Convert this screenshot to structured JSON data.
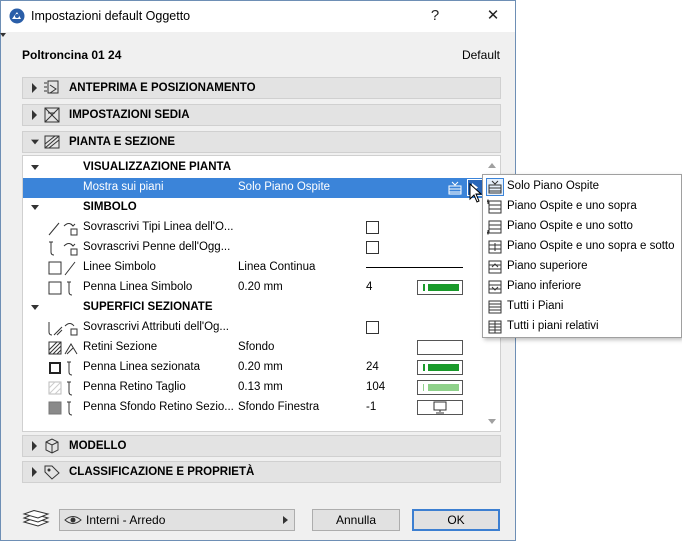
{
  "window": {
    "title": "Impostazioni default Oggetto",
    "help_glyph": "?",
    "close_glyph": "✕"
  },
  "header": {
    "object_name": "Poltroncina 01 24",
    "default_label": "Default"
  },
  "sections": {
    "preview": "ANTEPRIMA E POSIZIONAMENTO",
    "chair": "IMPOSTAZIONI SEDIA",
    "plan": "PIANTA E SEZIONE",
    "model": "MODELLO",
    "classification": "CLASSIFICAZIONE E PROPRIETÀ"
  },
  "plan_panel": {
    "group_display": "VISUALIZZAZIONE PIANTA",
    "show_on_floors": {
      "name": "Mostra sui piani",
      "value": "Solo Piano Ospite"
    },
    "group_symbol": "SIMBOLO",
    "override_line_types": {
      "name": "Sovrascrivi Tipi Linea dell'O...",
      "checked": false
    },
    "override_pens": {
      "name": "Sovrascrivi Penne dell'Ogg...",
      "checked": false
    },
    "symbol_lines": {
      "name": "Linee Simbolo",
      "value": "Linea Continua"
    },
    "symbol_line_pen": {
      "name": "Penna Linea Simbolo",
      "value": "0.20 mm",
      "pen": "4",
      "pen_color": "#1a9a2a"
    },
    "group_cut": "SUPERFICI SEZIONATE",
    "override_cut_attrs": {
      "name": "Sovrascrivi Attributi dell'Og...",
      "checked": false
    },
    "cut_fills": {
      "name": "Retini Sezione",
      "value": "Sfondo"
    },
    "cut_line_pen": {
      "name": "Penna Linea sezionata",
      "value": "0.20 mm",
      "pen": "24",
      "pen_color": "#1a9a2a"
    },
    "cut_fill_pen": {
      "name": "Penna Retino Taglio",
      "value": "0.13 mm",
      "pen": "104",
      "pen_color": "#8fd18a"
    },
    "cut_bg_pen": {
      "name": "Penna Sfondo Retino Sezio...",
      "value": "Sfondo Finestra",
      "pen": "-1"
    }
  },
  "footer": {
    "layer_combo": "Interni - Arredo",
    "cancel_label": "Annulla",
    "ok_label": "OK"
  },
  "floor_menu": {
    "items": [
      "Solo Piano Ospite",
      "Piano Ospite e uno sopra",
      "Piano Ospite e uno sotto",
      "Piano Ospite e uno sopra e sotto",
      "Piano superiore",
      "Piano inferiore",
      "Tutti i Piani",
      "Tutti i piani relativi"
    ],
    "active_index": 0
  },
  "colors": {
    "selection": "#3b84d9",
    "pen_green": "#1a9a2a",
    "pen_light_green": "#8fd18a"
  }
}
